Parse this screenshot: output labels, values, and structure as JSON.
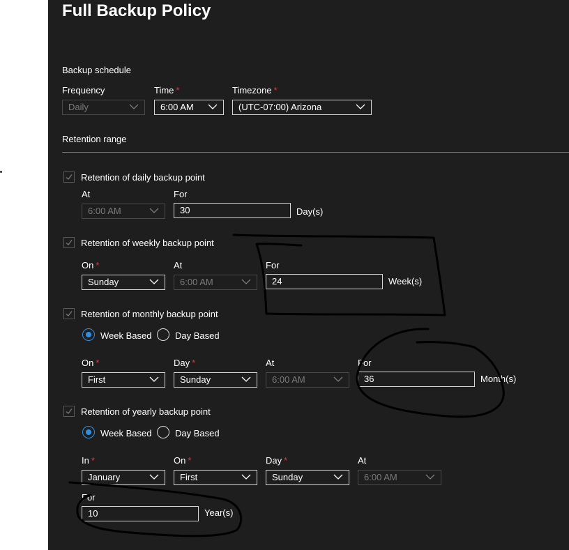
{
  "title": "Full Backup Policy",
  "schedule": {
    "heading": "Backup schedule",
    "frequency_label": "Frequency",
    "frequency_value": "Daily",
    "time_label": "Time",
    "time_value": "6:00 AM",
    "timezone_label": "Timezone",
    "timezone_value": "(UTC-07:00) Arizona",
    "required_mark": "*"
  },
  "retention": {
    "heading": "Retention range",
    "daily": {
      "label": "Retention of daily backup point",
      "at_label": "At",
      "at_value": "6:00 AM",
      "for_label": "For",
      "for_value": "30",
      "unit": "Day(s)"
    },
    "weekly": {
      "label": "Retention of weekly backup point",
      "on_label": "On",
      "on_value": "Sunday",
      "at_label": "At",
      "at_value": "6:00 AM",
      "for_label": "For",
      "for_value": "24",
      "unit": "Week(s)"
    },
    "monthly": {
      "label": "Retention of monthly backup point",
      "week_based": "Week Based",
      "day_based": "Day Based",
      "on_label": "On",
      "on_value": "First",
      "day_label": "Day",
      "day_value": "Sunday",
      "at_label": "At",
      "at_value": "6:00 AM",
      "for_label": "For",
      "for_value": "36",
      "unit": "Month(s)"
    },
    "yearly": {
      "label": "Retention of yearly backup point",
      "week_based": "Week Based",
      "day_based": "Day Based",
      "in_label": "In",
      "in_value": "January",
      "on_label": "On",
      "on_value": "First",
      "day_label": "Day",
      "day_value": "Sunday",
      "at_label": "At",
      "at_value": "6:00 AM",
      "for_label": "For",
      "for_value": "10",
      "unit": "Year(s)"
    }
  },
  "colors": {
    "panel_bg": "#1f1e1e",
    "required": "#e6333a",
    "radio_accent": "#2f8fe0",
    "annotation": "#000000"
  },
  "icons": [
    "chevron-down-icon",
    "checkmark-icon",
    "radio-selected-icon"
  ]
}
